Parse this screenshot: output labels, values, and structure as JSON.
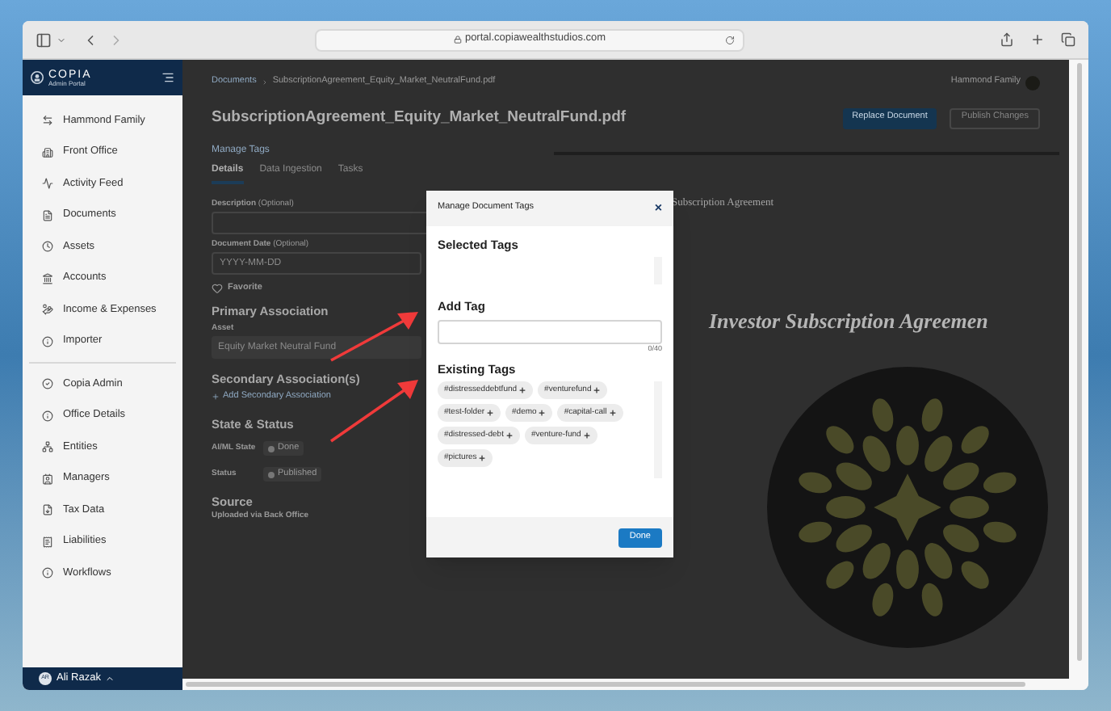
{
  "browser": {
    "url": "portal.copiawealthstudios.com"
  },
  "sidebar": {
    "brand": "COPIA",
    "subtitle": "Admin Portal",
    "items": [
      {
        "label": "Hammond Family"
      },
      {
        "label": "Front Office"
      },
      {
        "label": "Activity Feed"
      },
      {
        "label": "Documents"
      },
      {
        "label": "Assets"
      },
      {
        "label": "Accounts"
      },
      {
        "label": "Income & Expenses"
      },
      {
        "label": "Importer"
      }
    ],
    "admin_items": [
      {
        "label": "Copia Admin"
      },
      {
        "label": "Office Details"
      },
      {
        "label": "Entities"
      },
      {
        "label": "Managers"
      },
      {
        "label": "Tax Data"
      },
      {
        "label": "Liabilities"
      },
      {
        "label": "Workflows"
      }
    ],
    "user": {
      "initials": "AR",
      "name": "Ali Razak"
    }
  },
  "main": {
    "breadcrumb": [
      "Documents",
      "SubscriptionAgreement_Equity_Market_NeutralFund.pdf"
    ],
    "account": "Hammond Family",
    "title": "SubscriptionAgreement_Equity_Market_NeutralFund.pdf",
    "buttons": [
      {
        "label": "Replace Document",
        "disabled": false
      },
      {
        "label": "Publish Changes",
        "disabled": true
      }
    ],
    "manage_tags": "Manage Tags",
    "tabs": [
      {
        "label": "Details",
        "selected": true
      },
      {
        "label": "Data Ingestion",
        "selected": false
      },
      {
        "label": "Tasks",
        "selected": false
      }
    ],
    "description": {
      "label": "Description",
      "optional": "(Optional)"
    },
    "document_date": {
      "label": "Document Date",
      "optional": "(Optional)",
      "placeholder": "YYYY-MM-DD"
    },
    "favorite": {
      "label": "Favorite",
      "checked": false
    },
    "primary_association": {
      "heading": "Primary Association",
      "label": "Asset",
      "value": "Equity Market Neutral Fund"
    },
    "secondary_association": {
      "heading": "Secondary Association(s)",
      "link": "Add Secondary Association"
    },
    "state_status": {
      "heading": "State & Status",
      "rows": [
        {
          "label": "AI/ML State",
          "value": "Done"
        },
        {
          "label": "Status",
          "value": "Published"
        }
      ]
    },
    "source": {
      "heading": "Source",
      "value": "Uploaded via Back Office"
    },
    "preview": {
      "header": "Subscription Agreement",
      "heading": "Investor Subscription Agreemen"
    }
  },
  "modal": {
    "title": "Manage Document Tags",
    "close": "×",
    "selected_heading": "Selected Tags",
    "add_heading": "Add Tag",
    "counter": "0/40",
    "existing_heading": "Existing Tags",
    "tags": [
      "#distresseddebtfund",
      "#venturefund",
      "#test-folder",
      "#demo",
      "#capital-call",
      "#distressed-debt",
      "#venture-fund",
      "#pictures"
    ],
    "done": "Done"
  }
}
